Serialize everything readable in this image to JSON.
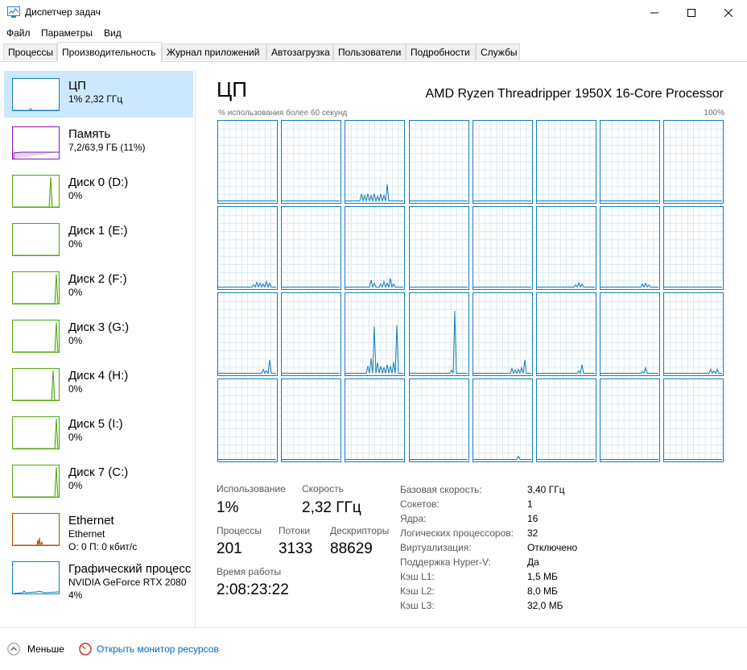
{
  "window": {
    "title": "Диспетчер задач"
  },
  "menu": [
    "Файл",
    "Параметры",
    "Вид"
  ],
  "tabs": [
    "Процессы",
    "Производительность",
    "Журнал приложений",
    "Автозагрузка",
    "Пользователи",
    "Подробности",
    "Службы"
  ],
  "active_tab": 1,
  "sidebar": [
    {
      "name": "ЦП",
      "sub1": "1% 2,32 ГГц",
      "sub2": "",
      "color": "#117dbb",
      "selected": true
    },
    {
      "name": "Память",
      "sub1": "7,2/63,9 ГБ (11%)",
      "sub2": "",
      "color": "#8b12ae",
      "selected": false
    },
    {
      "name": "Диск 0 (D:)",
      "sub1": "0%",
      "sub2": "",
      "color": "#4da60c",
      "selected": false
    },
    {
      "name": "Диск 1 (E:)",
      "sub1": "0%",
      "sub2": "",
      "color": "#4da60c",
      "selected": false
    },
    {
      "name": "Диск 2 (F:)",
      "sub1": "0%",
      "sub2": "",
      "color": "#4da60c",
      "selected": false
    },
    {
      "name": "Диск 3 (G:)",
      "sub1": "0%",
      "sub2": "",
      "color": "#4da60c",
      "selected": false
    },
    {
      "name": "Диск 4 (H:)",
      "sub1": "0%",
      "sub2": "",
      "color": "#4da60c",
      "selected": false
    },
    {
      "name": "Диск 5 (I:)",
      "sub1": "0%",
      "sub2": "",
      "color": "#4da60c",
      "selected": false
    },
    {
      "name": "Диск 7 (C:)",
      "sub1": "0%",
      "sub2": "",
      "color": "#4da60c",
      "selected": false
    },
    {
      "name": "Ethernet",
      "sub1": "Ethernet",
      "sub2": "О: 0 П: 0 кбит/с",
      "color": "#a74f01",
      "selected": false
    },
    {
      "name": "Графический процесс",
      "sub1": "NVIDIA GeForce RTX 2080",
      "sub2": "4%",
      "color": "#117dbb",
      "selected": false
    }
  ],
  "main": {
    "title": "ЦП",
    "model": "AMD Ryzen Threadripper 1950X 16-Core Processor",
    "graph_label": "% использования более 60 секунд",
    "graph_max": "100%",
    "graph_color": "#117dbb",
    "grid_color": "#d9eaf4"
  },
  "stats": {
    "usage_label": "Использование",
    "usage": "1%",
    "speed_label": "Скорость",
    "speed": "2,32 ГГц",
    "processes_label": "Процессы",
    "processes": "201",
    "threads_label": "Потоки",
    "threads": "3133",
    "handles_label": "Дескрипторы",
    "handles": "88629",
    "uptime_label": "Время работы",
    "uptime": "2:08:23:22"
  },
  "info": [
    {
      "label": "Базовая скорость:",
      "value": "3,40 ГГц"
    },
    {
      "label": "Сокетов:",
      "value": "1"
    },
    {
      "label": "Ядра:",
      "value": "16"
    },
    {
      "label": "Логических процессоров:",
      "value": "32"
    },
    {
      "label": "Виртуализация:",
      "value": "Отключено"
    },
    {
      "label": "Поддержка Hyper-V:",
      "value": "Да"
    },
    {
      "label": "Кэш L1:",
      "value": "1,5 МБ"
    },
    {
      "label": "Кэш L2:",
      "value": "8,0 МБ"
    },
    {
      "label": "Кэш L3:",
      "value": "32,0 МБ"
    }
  ],
  "footer": {
    "less": "Меньше",
    "resmon": "Открыть монитор ресурсов"
  }
}
